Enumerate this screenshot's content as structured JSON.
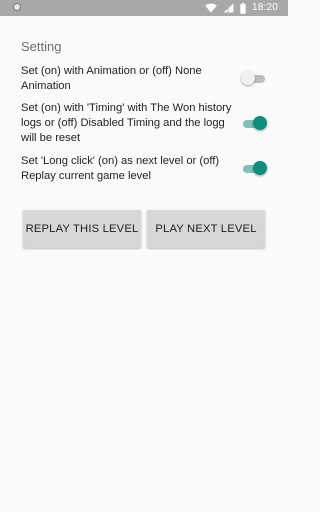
{
  "status_bar": {
    "time": "18:20",
    "icons": [
      "notification-dot-icon",
      "wifi-icon",
      "signal-icon",
      "battery-icon"
    ]
  },
  "settings": {
    "title": "Setting",
    "items": [
      {
        "label": "Set (on) with Animation or (off) None Animation",
        "enabled": false
      },
      {
        "label": "Set (on) with 'Timing' with The Won history logs or (off) Disabled Timing and the logg will be reset",
        "enabled": true
      },
      {
        "label": "Set 'Long click' (on) as next level or (off) Replay current game level",
        "enabled": true
      }
    ]
  },
  "buttons": {
    "replay_label": "REPLAY THIS LEVEL",
    "next_label": "PLAY NEXT LEVEL"
  },
  "colors": {
    "accent": "#0f8d7d",
    "accent_track": "#7fc1b8",
    "status_bar": "#a8a8a8",
    "background": "#fafafa",
    "button": "#d6d7d7"
  }
}
